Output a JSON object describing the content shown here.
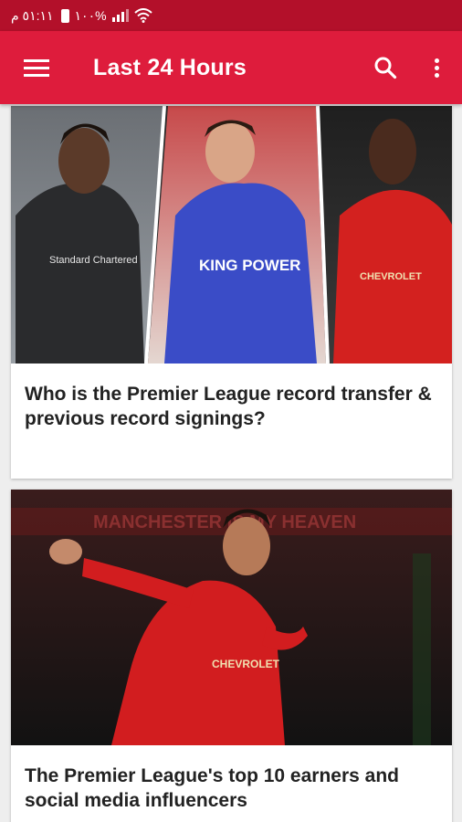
{
  "status_bar": {
    "text": "١١:١٥ م",
    "battery_text": "١٠٠%"
  },
  "app_bar": {
    "title": "Last 24 Hours",
    "menu_icon": "hamburger-menu-icon",
    "search_icon": "search-icon",
    "more_icon": "more-vert-icon"
  },
  "articles": [
    {
      "title": "Who is the Premier League record transfer & previous record signings?",
      "image_texts": [
        "Standard Chartered",
        "KING POWER",
        "CHEVROLET"
      ]
    },
    {
      "title": "The Premier League's top 10 earners and social media influencers",
      "image_texts": [
        "MANCHESTER IS MY HEAVEN",
        "CHEVROLET"
      ]
    }
  ],
  "colors": {
    "status_bar": "#b3102a",
    "app_bar": "#de1c3c",
    "background": "#eeeeee"
  }
}
